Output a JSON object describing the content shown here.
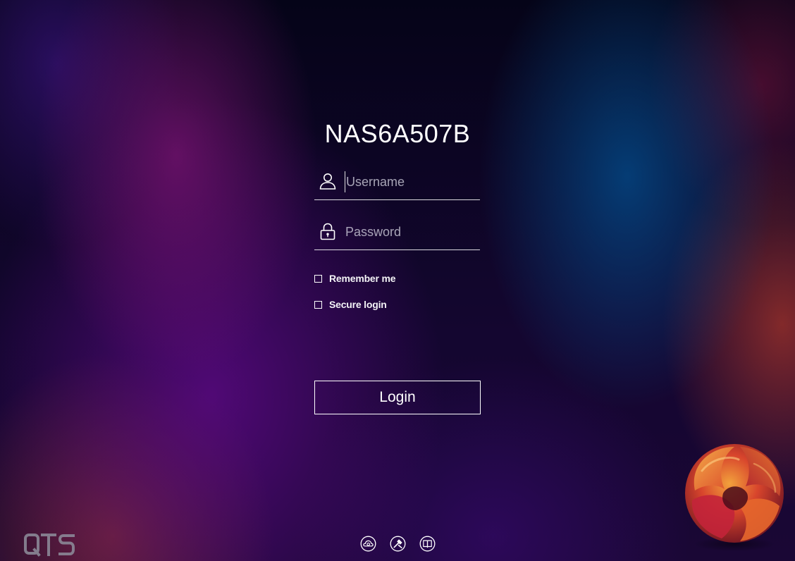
{
  "device": {
    "name": "NAS6A507B"
  },
  "form": {
    "username_placeholder": "Username",
    "password_placeholder": "Password",
    "username_value": "",
    "password_value": "",
    "remember_label": "Remember me",
    "remember_checked": false,
    "secure_label": "Secure login",
    "secure_checked": false,
    "login_label": "Login"
  },
  "icons": {
    "user": "user-icon",
    "lock": "lock-icon",
    "footer": [
      "cloud-icon",
      "tools-icon",
      "book-icon"
    ]
  },
  "brand": {
    "wordmark": "QTS",
    "colors": {
      "orb_orange": "#f08a2a",
      "orb_red": "#c8283a",
      "orb_dark": "#6a1420"
    }
  }
}
